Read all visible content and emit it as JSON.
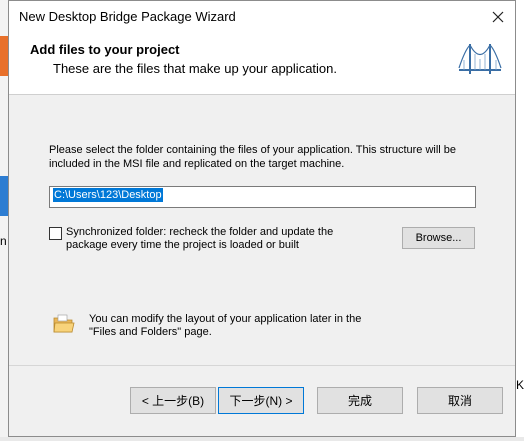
{
  "background": {
    "left_text": "n",
    "right_text": "K"
  },
  "window": {
    "title": "New Desktop Bridge Package Wizard"
  },
  "header": {
    "title": "Add files to your project",
    "subtitle": "These are the files that make up your application."
  },
  "content": {
    "description": "Please select the folder containing the files of your application. This structure will be included in the MSI file and replicated on the target machine.",
    "path_value": "C:\\Users\\123\\Desktop",
    "sync_label": "Synchronized folder: recheck the folder and update the package every time the project is loaded or built",
    "sync_checked": false,
    "browse_label": "Browse...",
    "info_text": "You can modify the layout of your application later in the \"Files and Folders\" page."
  },
  "footer": {
    "back_label": "< 上一步(B)",
    "next_label": "下一步(N) >",
    "finish_label": "完成",
    "cancel_label": "取消"
  },
  "icons": {
    "close": "close-icon",
    "header": "bridge-icon",
    "info": "folder-icon"
  },
  "colors": {
    "accent": "#0078d7",
    "dialog_bg": "#f0f0f0",
    "header_bg": "#ffffff"
  }
}
